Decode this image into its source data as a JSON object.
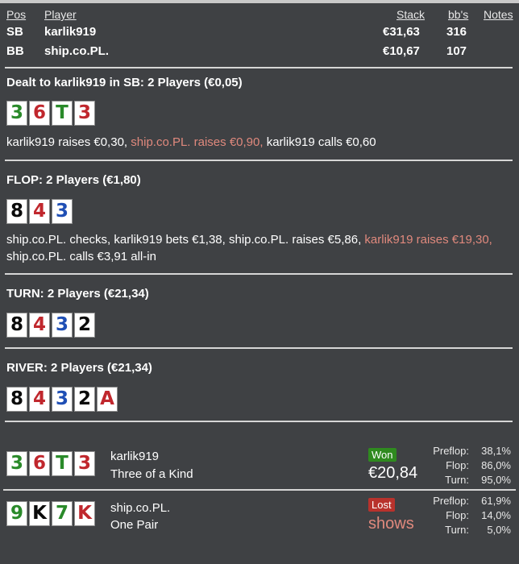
{
  "headers": {
    "pos": "Pos",
    "player": "Player",
    "stack": "Stack",
    "bbs": "bb's",
    "notes": "Notes"
  },
  "players": [
    {
      "pos": "SB",
      "name": "karlik919",
      "stack": "€31,63",
      "bbs": "316"
    },
    {
      "pos": "BB",
      "name": "ship.co.PL.",
      "stack": "€10,67",
      "bbs": "107"
    }
  ],
  "preflop": {
    "title": "Dealt to karlik919 in SB: 2 Players (€0,05)",
    "cards": [
      {
        "rank": "3",
        "suit": "clubs"
      },
      {
        "rank": "6",
        "suit": "hearts"
      },
      {
        "rank": "T",
        "suit": "clubs"
      },
      {
        "rank": "3",
        "suit": "hearts"
      }
    ],
    "action_1": "karlik919 raises €0,30,",
    "action_2": "ship.co.PL. raises €0,90,",
    "action_3": "karlik919 calls €0,60"
  },
  "flop": {
    "title": "FLOP: 2 Players (€1,80)",
    "cards": [
      {
        "rank": "8",
        "suit": "spades"
      },
      {
        "rank": "4",
        "suit": "hearts"
      },
      {
        "rank": "3",
        "suit": "diamonds"
      }
    ],
    "action_1": "ship.co.PL. checks, karlik919 bets €1,38, ship.co.PL. raises €5,86,",
    "action_2": "karlik919 raises €19,30,",
    "action_3": "ship.co.PL. calls €3,91 all-in"
  },
  "turn": {
    "title": "TURN: 2 Players (€21,34)",
    "cards": [
      {
        "rank": "8",
        "suit": "spades"
      },
      {
        "rank": "4",
        "suit": "hearts"
      },
      {
        "rank": "3",
        "suit": "diamonds"
      },
      {
        "rank": "2",
        "suit": "spades"
      }
    ]
  },
  "river": {
    "title": "RIVER: 2 Players (€21,34)",
    "cards": [
      {
        "rank": "8",
        "suit": "spades"
      },
      {
        "rank": "4",
        "suit": "hearts"
      },
      {
        "rank": "3",
        "suit": "diamonds"
      },
      {
        "rank": "2",
        "suit": "spades"
      },
      {
        "rank": "A",
        "suit": "hearts"
      }
    ]
  },
  "showdown": [
    {
      "name": "karlik919",
      "hand": "Three of a Kind",
      "cards": [
        {
          "rank": "3",
          "suit": "clubs"
        },
        {
          "rank": "6",
          "suit": "hearts"
        },
        {
          "rank": "T",
          "suit": "clubs"
        },
        {
          "rank": "3",
          "suit": "hearts"
        }
      ],
      "badge": "Won",
      "result": "€20,84",
      "equity": [
        {
          "label": "Preflop:",
          "value": "38,1%"
        },
        {
          "label": "Flop:",
          "value": "86,0%"
        },
        {
          "label": "Turn:",
          "value": "95,0%"
        }
      ]
    },
    {
      "name": "ship.co.PL.",
      "hand": "One Pair",
      "cards": [
        {
          "rank": "9",
          "suit": "clubs"
        },
        {
          "rank": "K",
          "suit": "spades"
        },
        {
          "rank": "7",
          "suit": "clubs"
        },
        {
          "rank": "K",
          "suit": "hearts"
        }
      ],
      "badge": "Lost",
      "result": "shows",
      "equity": [
        {
          "label": "Preflop:",
          "value": "61,9%"
        },
        {
          "label": "Flop:",
          "value": "14,0%"
        },
        {
          "label": "Turn:",
          "value": "5,0%"
        }
      ]
    }
  ],
  "suit_colors": {
    "spades": "#0a0a0a",
    "hearts": "#c0272d",
    "clubs": "#2a8a2a",
    "diamonds": "#1f4fb5"
  }
}
